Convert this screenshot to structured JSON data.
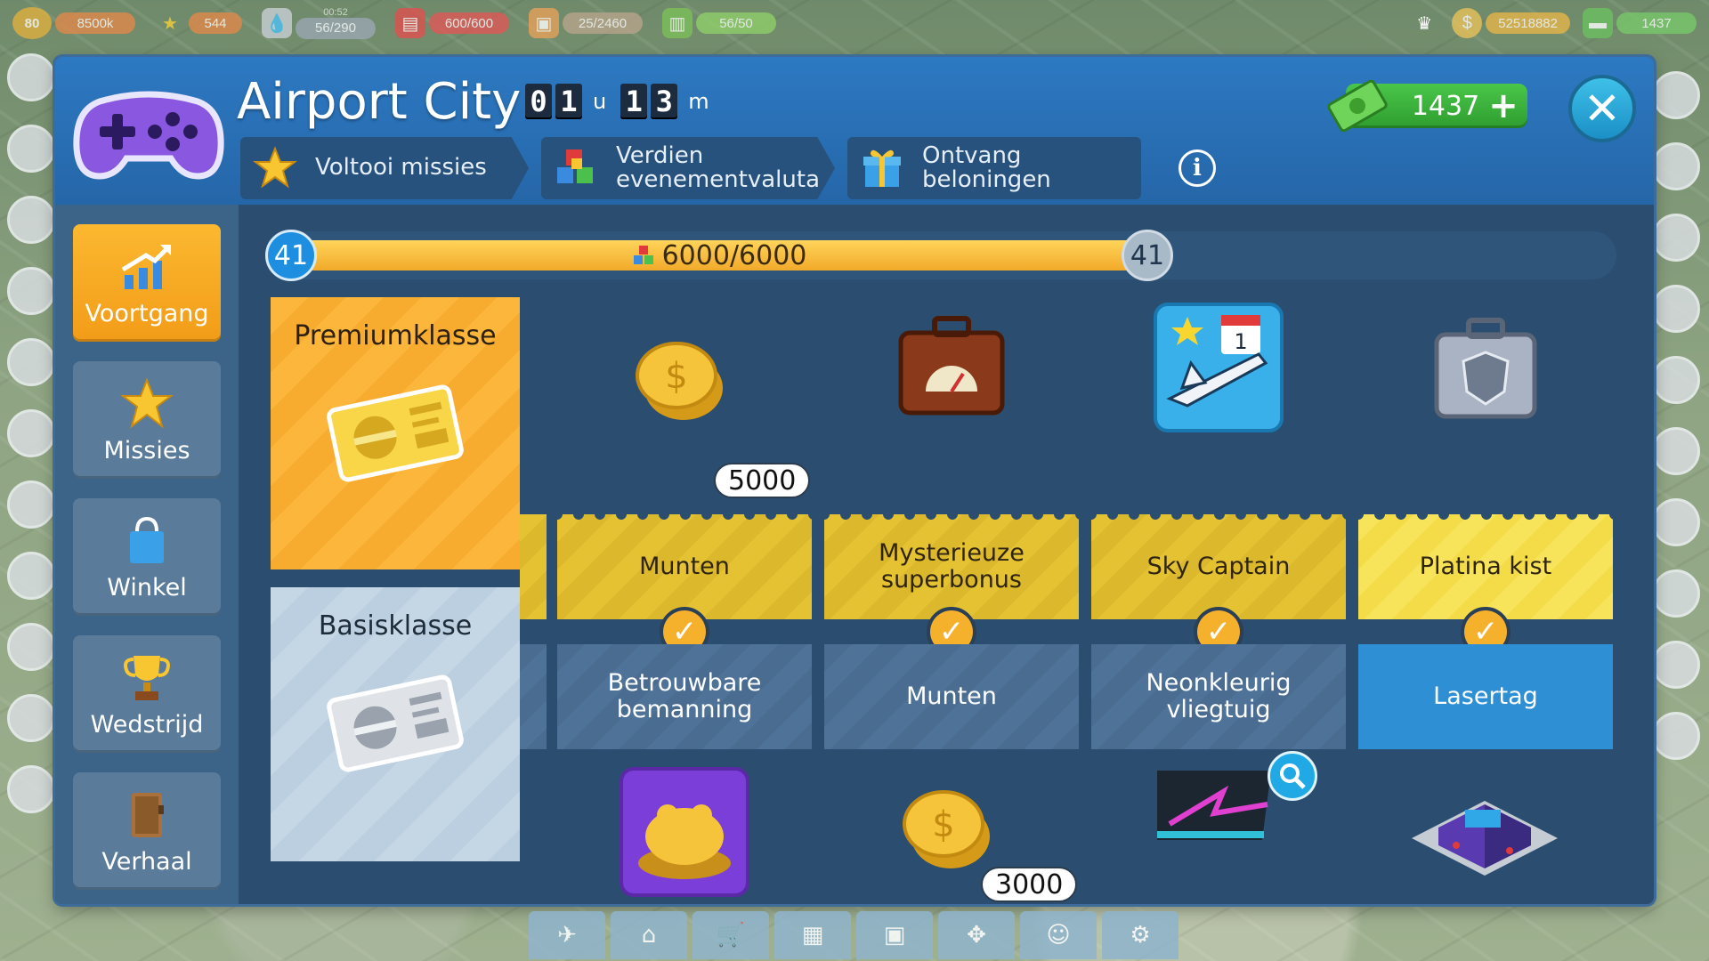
{
  "topbar": {
    "level": "80",
    "xp": "8500k",
    "stars": "544",
    "clock": "00:52",
    "fuel": "56/290",
    "storage1": "600/600",
    "storage2": "25/2460",
    "backpack": "56/50",
    "coins": "52518882",
    "cash": "1437"
  },
  "header": {
    "title": "Airport City",
    "timer": {
      "hours_d1": "0",
      "hours_d2": "1",
      "hours_unit": "u",
      "mins_d1": "1",
      "mins_d2": "3",
      "mins_unit": "m"
    },
    "tabs": [
      {
        "label": "Voltooi missies"
      },
      {
        "label": "Verdien evenementvaluta"
      },
      {
        "label": "Ontvang beloningen"
      }
    ],
    "info": "i",
    "cash_amount": "1437",
    "cash_plus": "+",
    "close": "✕"
  },
  "sidebar": {
    "items": [
      {
        "label": "Voortgang"
      },
      {
        "label": "Missies"
      },
      {
        "label": "Winkel"
      },
      {
        "label": "Wedstrijd"
      },
      {
        "label": "Verhaal"
      }
    ]
  },
  "progress": {
    "level_left": "41",
    "level_right": "41",
    "text": "6000/6000",
    "fill_fraction": 1.0
  },
  "tracks": {
    "premium": {
      "label": "Premiumklasse"
    },
    "basic": {
      "label": "Basisklasse"
    }
  },
  "rewards": [
    {
      "premium": "Munten",
      "premium_amount": "5000",
      "basic": "Betrouwbare bemanning",
      "basic_amount": ""
    },
    {
      "premium": "Mysterieuze superbonus",
      "premium_amount": "",
      "basic": "Munten",
      "basic_amount": "3000"
    },
    {
      "premium": "Sky Captain",
      "premium_amount": "",
      "basic": "Neonkleurig vliegtuig",
      "basic_amount": ""
    },
    {
      "premium": "Platina kist",
      "premium_amount": "",
      "basic": "Lasertag",
      "basic_amount": ""
    }
  ],
  "colors": {
    "panel": "#27486d",
    "header": "#2d79c2",
    "accent_orange": "#f29c18",
    "cash_green": "#2e9d2e",
    "close_blue": "#1b8fc6"
  }
}
